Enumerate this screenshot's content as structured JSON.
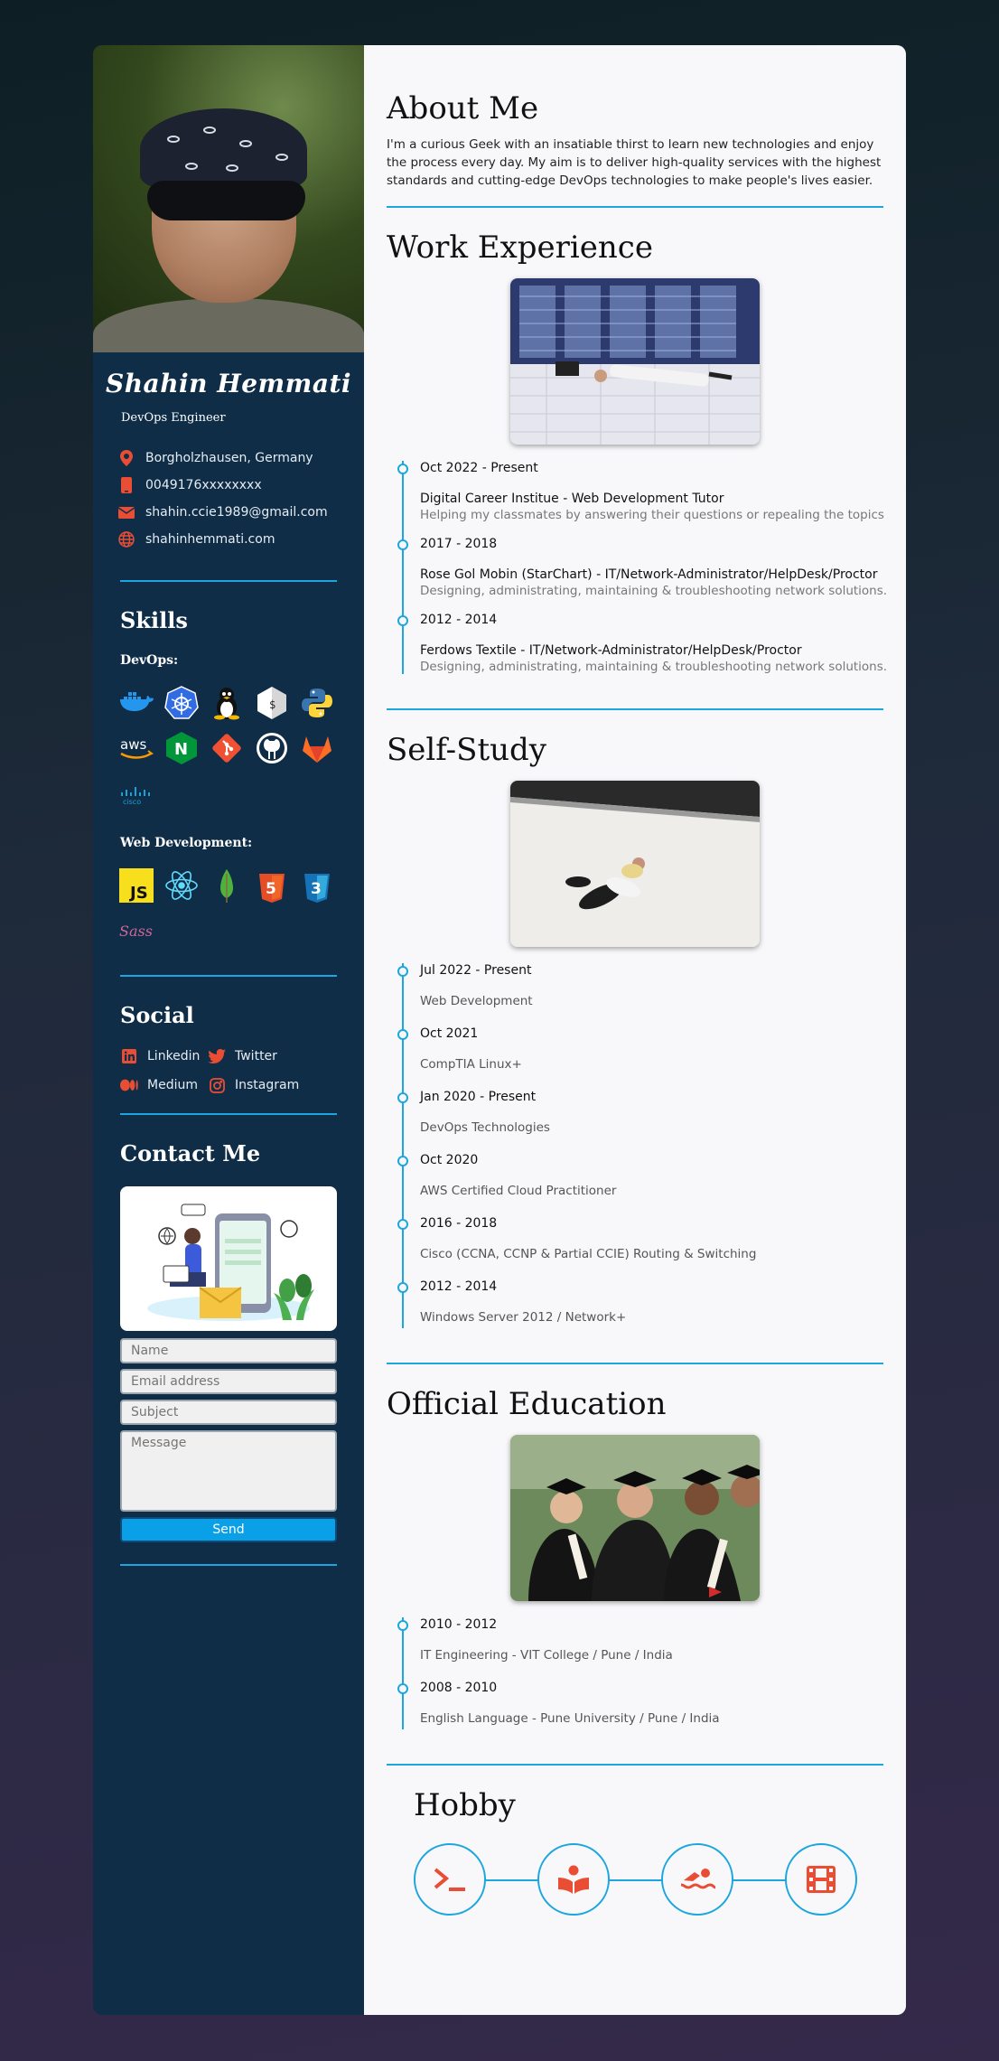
{
  "profile": {
    "name": "Shahin Hemmati",
    "role": "DevOps Engineer",
    "location": "Borgholzhausen, Germany",
    "phone": "0049176xxxxxxxx",
    "email": "shahin.ccie1989@gmail.com",
    "website": "shahinhemmati.com"
  },
  "skills": {
    "heading": "Skills",
    "devops_label": "DevOps:",
    "devops_icons": [
      "docker-icon",
      "kubernetes-icon",
      "linux-icon",
      "bash-icon",
      "python-icon",
      "aws-icon",
      "nginx-icon",
      "git-icon",
      "github-icon",
      "gitlab-icon",
      "cisco-icon"
    ],
    "web_label": "Web Development:",
    "web_icons": [
      "javascript-icon",
      "react-icon",
      "mongodb-icon",
      "html5-icon",
      "css3-icon",
      "sass-icon"
    ],
    "aws_text": "aws",
    "cisco_text": "cisco",
    "js_text": "JS",
    "nginx_text": "N",
    "html_text": "5",
    "css_text": "3",
    "sass_text": "Sass"
  },
  "social": {
    "heading": "Social",
    "linkedin": "Linkedin",
    "twitter": "Twitter",
    "medium": "Medium",
    "instagram": "Instagram"
  },
  "contact": {
    "heading": "Contact Me",
    "name_placeholder": "Name",
    "email_placeholder": "Email address",
    "subject_placeholder": "Subject",
    "message_placeholder": "Message",
    "send_label": "Send"
  },
  "about": {
    "heading": "About Me",
    "text": "I'm a curious Geek with an insatiable thirst to learn new technologies and enjoy the process every day. My aim is to deliver high-quality services with the highest standards and cutting-edge DevOps technologies to make people's lives easier."
  },
  "work": {
    "heading": "Work Experience",
    "items": [
      {
        "date": "Oct 2022 - Present",
        "title": "Digital Career Institue - Web Development Tutor",
        "desc": "Helping my classmates by answering their questions or repealing the topics"
      },
      {
        "date": "2017 - 2018",
        "title": "Rose Gol Mobin (StarChart) - IT/Network-Administrator/HelpDesk/Proctor",
        "desc": "Designing, administrating, maintaining & troubleshooting network solutions."
      },
      {
        "date": "2012 - 2014",
        "title": "Ferdows Textile - IT/Network-Administrator/HelpDesk/Proctor",
        "desc": "Designing, administrating, maintaining & troubleshooting network solutions."
      }
    ]
  },
  "study": {
    "heading": "Self-Study",
    "items": [
      {
        "date": "Jul 2022 - Present",
        "text": "Web Development"
      },
      {
        "date": "Oct 2021",
        "text": "CompTIA Linux+"
      },
      {
        "date": "Jan 2020 - Present",
        "text": "DevOps Technologies"
      },
      {
        "date": "Oct 2020",
        "text": "AWS Certified Cloud Practitioner"
      },
      {
        "date": "2016 - 2018",
        "text": "Cisco (CCNA, CCNP & Partial CCIE) Routing & Switching"
      },
      {
        "date": "2012 - 2014",
        "text": "Windows Server 2012 / Network+"
      }
    ]
  },
  "education": {
    "heading": "Official Education",
    "items": [
      {
        "date": "2010 - 2012",
        "text": "IT Engineering - VIT College / Pune / India"
      },
      {
        "date": "2008 - 2010",
        "text": "English Language - Pune University / Pune / India"
      }
    ]
  },
  "hobby": {
    "heading": "Hobby",
    "icons": [
      "terminal-icon",
      "book-reader-icon",
      "swimming-icon",
      "film-icon"
    ]
  },
  "colors": {
    "sidebar": "#0f2d47",
    "accent": "#1ba6e0",
    "icon_red": "#e94e35",
    "send": "#0aa0e8"
  }
}
